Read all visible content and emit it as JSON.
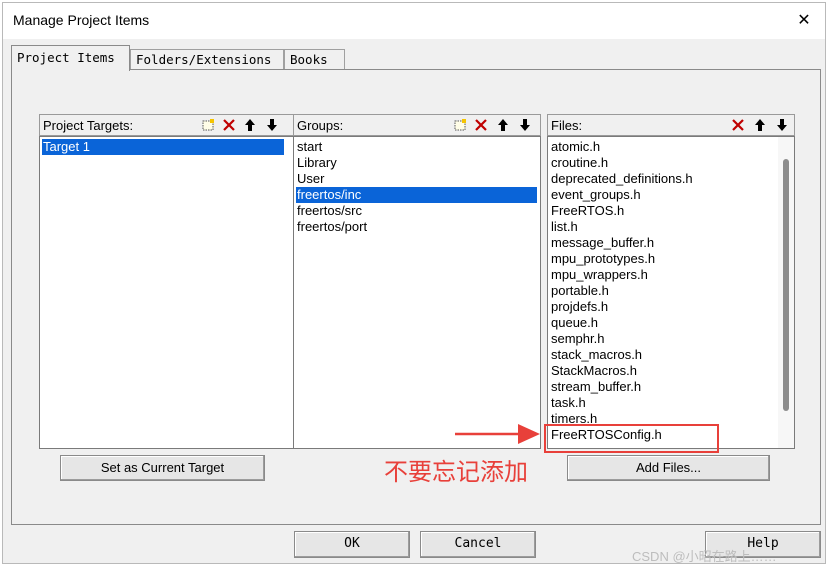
{
  "window": {
    "title": "Manage Project Items",
    "close_label": "✕"
  },
  "tabs": [
    {
      "label": "Project Items"
    },
    {
      "label": "Folders/Extensions"
    },
    {
      "label": "Books"
    }
  ],
  "targets": {
    "header": "Project Targets:",
    "items": [
      {
        "label": "Target 1"
      }
    ],
    "selected": "Target 1",
    "set_current_button": "Set as Current Target"
  },
  "groups": {
    "header": "Groups:",
    "items": [
      {
        "label": "start"
      },
      {
        "label": "Library"
      },
      {
        "label": "User"
      },
      {
        "label": "freertos/inc"
      },
      {
        "label": "freertos/src"
      },
      {
        "label": "freertos/port"
      }
    ],
    "selected": "freertos/inc"
  },
  "files": {
    "header": "Files:",
    "items": [
      {
        "label": "atomic.h"
      },
      {
        "label": "croutine.h"
      },
      {
        "label": "deprecated_definitions.h"
      },
      {
        "label": "event_groups.h"
      },
      {
        "label": "FreeRTOS.h"
      },
      {
        "label": "list.h"
      },
      {
        "label": "message_buffer.h"
      },
      {
        "label": "mpu_prototypes.h"
      },
      {
        "label": "mpu_wrappers.h"
      },
      {
        "label": "portable.h"
      },
      {
        "label": "projdefs.h"
      },
      {
        "label": "queue.h"
      },
      {
        "label": "semphr.h"
      },
      {
        "label": "stack_macros.h"
      },
      {
        "label": "StackMacros.h"
      },
      {
        "label": "stream_buffer.h"
      },
      {
        "label": "task.h"
      },
      {
        "label": "timers.h"
      },
      {
        "label": "FreeRTOSConfig.h"
      }
    ],
    "add_files_button": "Add Files..."
  },
  "annotation": {
    "text": "不要忘记添加",
    "color": "#e8403a"
  },
  "footer": {
    "ok": "OK",
    "cancel": "Cancel",
    "help": "Help"
  },
  "watermark": "CSDN @小昭在路上……"
}
